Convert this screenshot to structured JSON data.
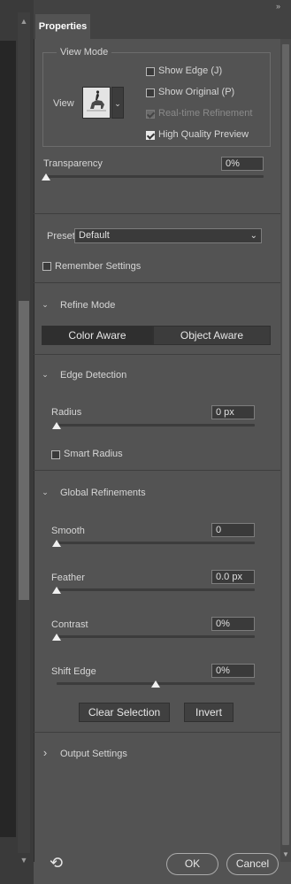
{
  "panel": {
    "tab_title": "Properties"
  },
  "view_mode": {
    "legend": "View Mode",
    "view_label": "View",
    "options": [
      {
        "label": "Show Edge (J)",
        "checked": false,
        "enabled": true
      },
      {
        "label": "Show Original (P)",
        "checked": false,
        "enabled": true
      },
      {
        "label": "Real-time Refinement",
        "checked": true,
        "enabled": false
      },
      {
        "label": "High Quality Preview",
        "checked": true,
        "enabled": true
      }
    ]
  },
  "transparency": {
    "label": "Transparency",
    "value": "0%",
    "level": 0
  },
  "preset": {
    "label": "Preset",
    "value": "Default"
  },
  "remember_settings": {
    "label": "Remember Settings",
    "checked": false
  },
  "refine_mode": {
    "title": "Refine Mode",
    "buttons": [
      "Color Aware",
      "Object Aware"
    ]
  },
  "edge_detection": {
    "title": "Edge Detection",
    "radius": {
      "label": "Radius",
      "value": "0 px",
      "level": 0
    },
    "smart_radius": {
      "label": "Smart Radius",
      "checked": false
    }
  },
  "global_refinements": {
    "title": "Global Refinements",
    "smooth": {
      "label": "Smooth",
      "value": "0",
      "level": 0
    },
    "feather": {
      "label": "Feather",
      "value": "0.0 px",
      "level": 0
    },
    "contrast": {
      "label": "Contrast",
      "value": "0%",
      "level": 0
    },
    "shift_edge": {
      "label": "Shift Edge",
      "value": "0%",
      "level": 0.5
    },
    "clear_selection": "Clear Selection",
    "invert": "Invert"
  },
  "output_settings": {
    "title": "Output Settings"
  },
  "footer": {
    "ok": "OK",
    "cancel": "Cancel"
  },
  "glyphs": {
    "collapse": "»",
    "chevron_down": "⌄",
    "chevron_right": "›",
    "caret": "⌄",
    "up": "▲",
    "down": "▼",
    "reset": "⟲"
  }
}
